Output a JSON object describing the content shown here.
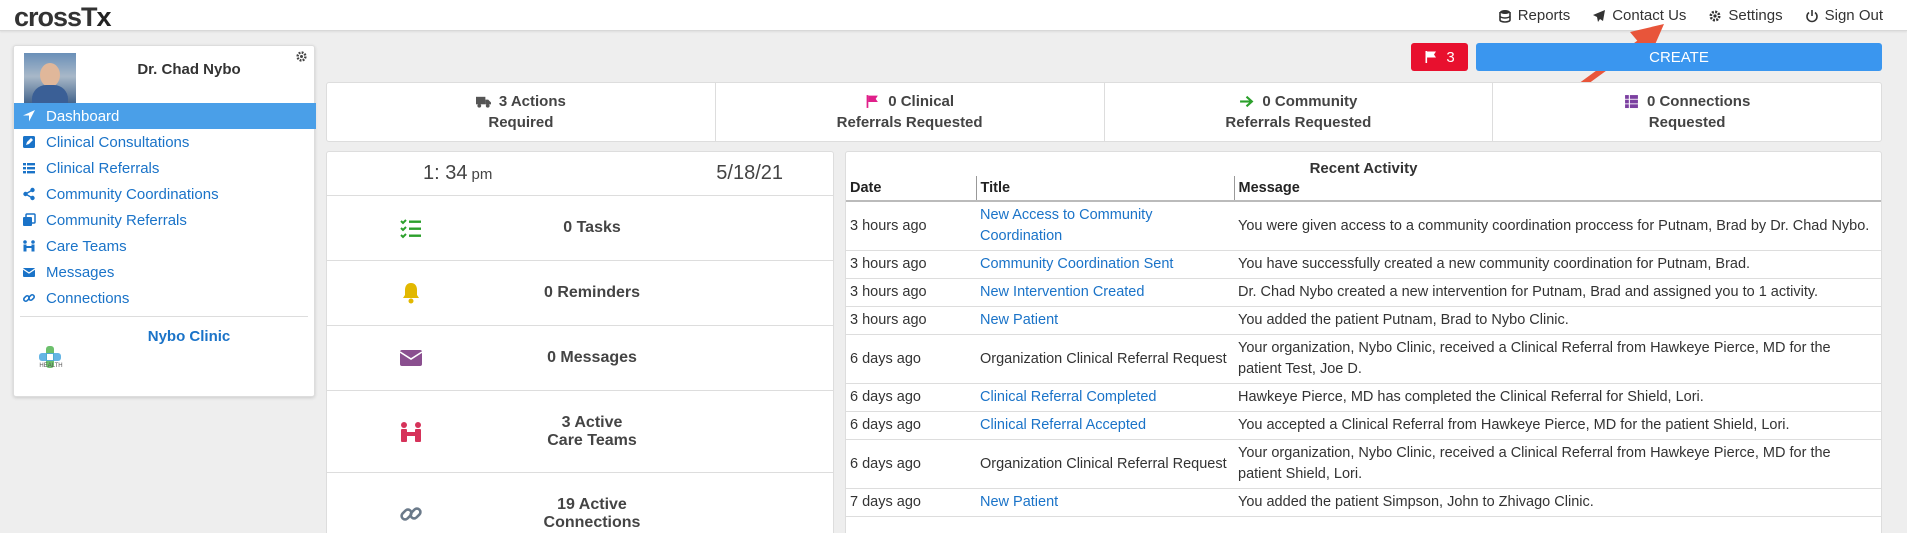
{
  "app": {
    "logo_cross": "crossT",
    "logo_x": "x"
  },
  "nav": {
    "reports": "Reports",
    "contact": "Contact Us",
    "settings": "Settings",
    "signout": "Sign Out"
  },
  "profile": {
    "name": "Dr. Chad Nybo",
    "clinic": "Nybo Clinic",
    "clinic_logo_text": "HEALTH"
  },
  "menu": {
    "items": [
      {
        "label": "Dashboard"
      },
      {
        "label": "Clinical Consultations"
      },
      {
        "label": "Clinical Referrals"
      },
      {
        "label": "Community Coordinations"
      },
      {
        "label": "Community Referrals"
      },
      {
        "label": "Care Teams"
      },
      {
        "label": "Messages"
      },
      {
        "label": "Connections"
      }
    ]
  },
  "toolbar": {
    "flag_count": "3",
    "create_label": "CREATE"
  },
  "summary": [
    {
      "line1": "3 Actions",
      "line2": "Required",
      "icon": "truck-icon",
      "color": "#555555"
    },
    {
      "line1": "0 Clinical",
      "line2": "Referrals Requested",
      "icon": "flag-icon",
      "color": "#e0208a"
    },
    {
      "line1": "0 Community",
      "line2": "Referrals Requested",
      "icon": "arrow-right-icon",
      "color": "#2ca02c"
    },
    {
      "line1": "0 Connections",
      "line2": "Requested",
      "icon": "list-icon",
      "color": "#7b3fa0"
    }
  ],
  "clock": {
    "time": "1: 34",
    "ampm": "pm",
    "date": "5/18/21"
  },
  "stats": [
    {
      "line1": "0 Tasks",
      "line2": "",
      "icon": "tasks-icon",
      "color": "#2ca02c"
    },
    {
      "line1": "0 Reminders",
      "line2": "",
      "icon": "bell-icon",
      "color": "#e2b800"
    },
    {
      "line1": "0 Messages",
      "line2": "",
      "icon": "envelope-icon",
      "color": "#8a4f8f"
    },
    {
      "line1": "3 Active",
      "line2": "Care Teams",
      "icon": "people-icon",
      "color": "#d6335a"
    },
    {
      "line1": "19 Active",
      "line2": "Connections",
      "icon": "link-icon",
      "color": "#6b7a8a"
    }
  ],
  "activity": {
    "title": "Recent Activity",
    "columns": [
      "Date",
      "Title",
      "Message"
    ],
    "rows": [
      {
        "date": "3 hours ago",
        "title": "New Access to Community Coordination",
        "link": true,
        "message": "You were given access to a community coordination proccess for Putnam, Brad by Dr. Chad Nybo."
      },
      {
        "date": "3 hours ago",
        "title": "Community Coordination Sent",
        "link": true,
        "message": "You have successfully created a new community coordination for Putnam, Brad."
      },
      {
        "date": "3 hours ago",
        "title": "New Intervention Created",
        "link": true,
        "message": "Dr. Chad Nybo created a new intervention for Putnam, Brad and assigned you to 1 activity."
      },
      {
        "date": "3 hours ago",
        "title": "New Patient",
        "link": true,
        "message": "You added the patient Putnam, Brad to Nybo Clinic."
      },
      {
        "date": "6 days ago",
        "title": "Organization Clinical Referral Request",
        "link": false,
        "message": "Your organization, Nybo Clinic, received a Clinical Referral from Hawkeye Pierce, MD for the patient Test, Joe D."
      },
      {
        "date": "6 days ago",
        "title": "Clinical Referral Completed",
        "link": true,
        "message": "Hawkeye Pierce, MD has completed the Clinical Referral for Shield, Lori."
      },
      {
        "date": "6 days ago",
        "title": "Clinical Referral Accepted",
        "link": true,
        "message": "You accepted a Clinical Referral from Hawkeye Pierce, MD for the patient Shield, Lori."
      },
      {
        "date": "6 days ago",
        "title": "Organization Clinical Referral Request",
        "link": false,
        "message": "Your organization, Nybo Clinic, received a Clinical Referral from Hawkeye Pierce, MD for the patient Shield, Lori."
      },
      {
        "date": "7 days ago",
        "title": "New Patient",
        "link": true,
        "message": "You added the patient Simpson, John to Zhivago Clinic."
      }
    ]
  },
  "colors": {
    "accent": "#3a96ef",
    "link": "#1a73c8",
    "flag": "#e8102e",
    "annotation_arrow": "#e8553a"
  }
}
